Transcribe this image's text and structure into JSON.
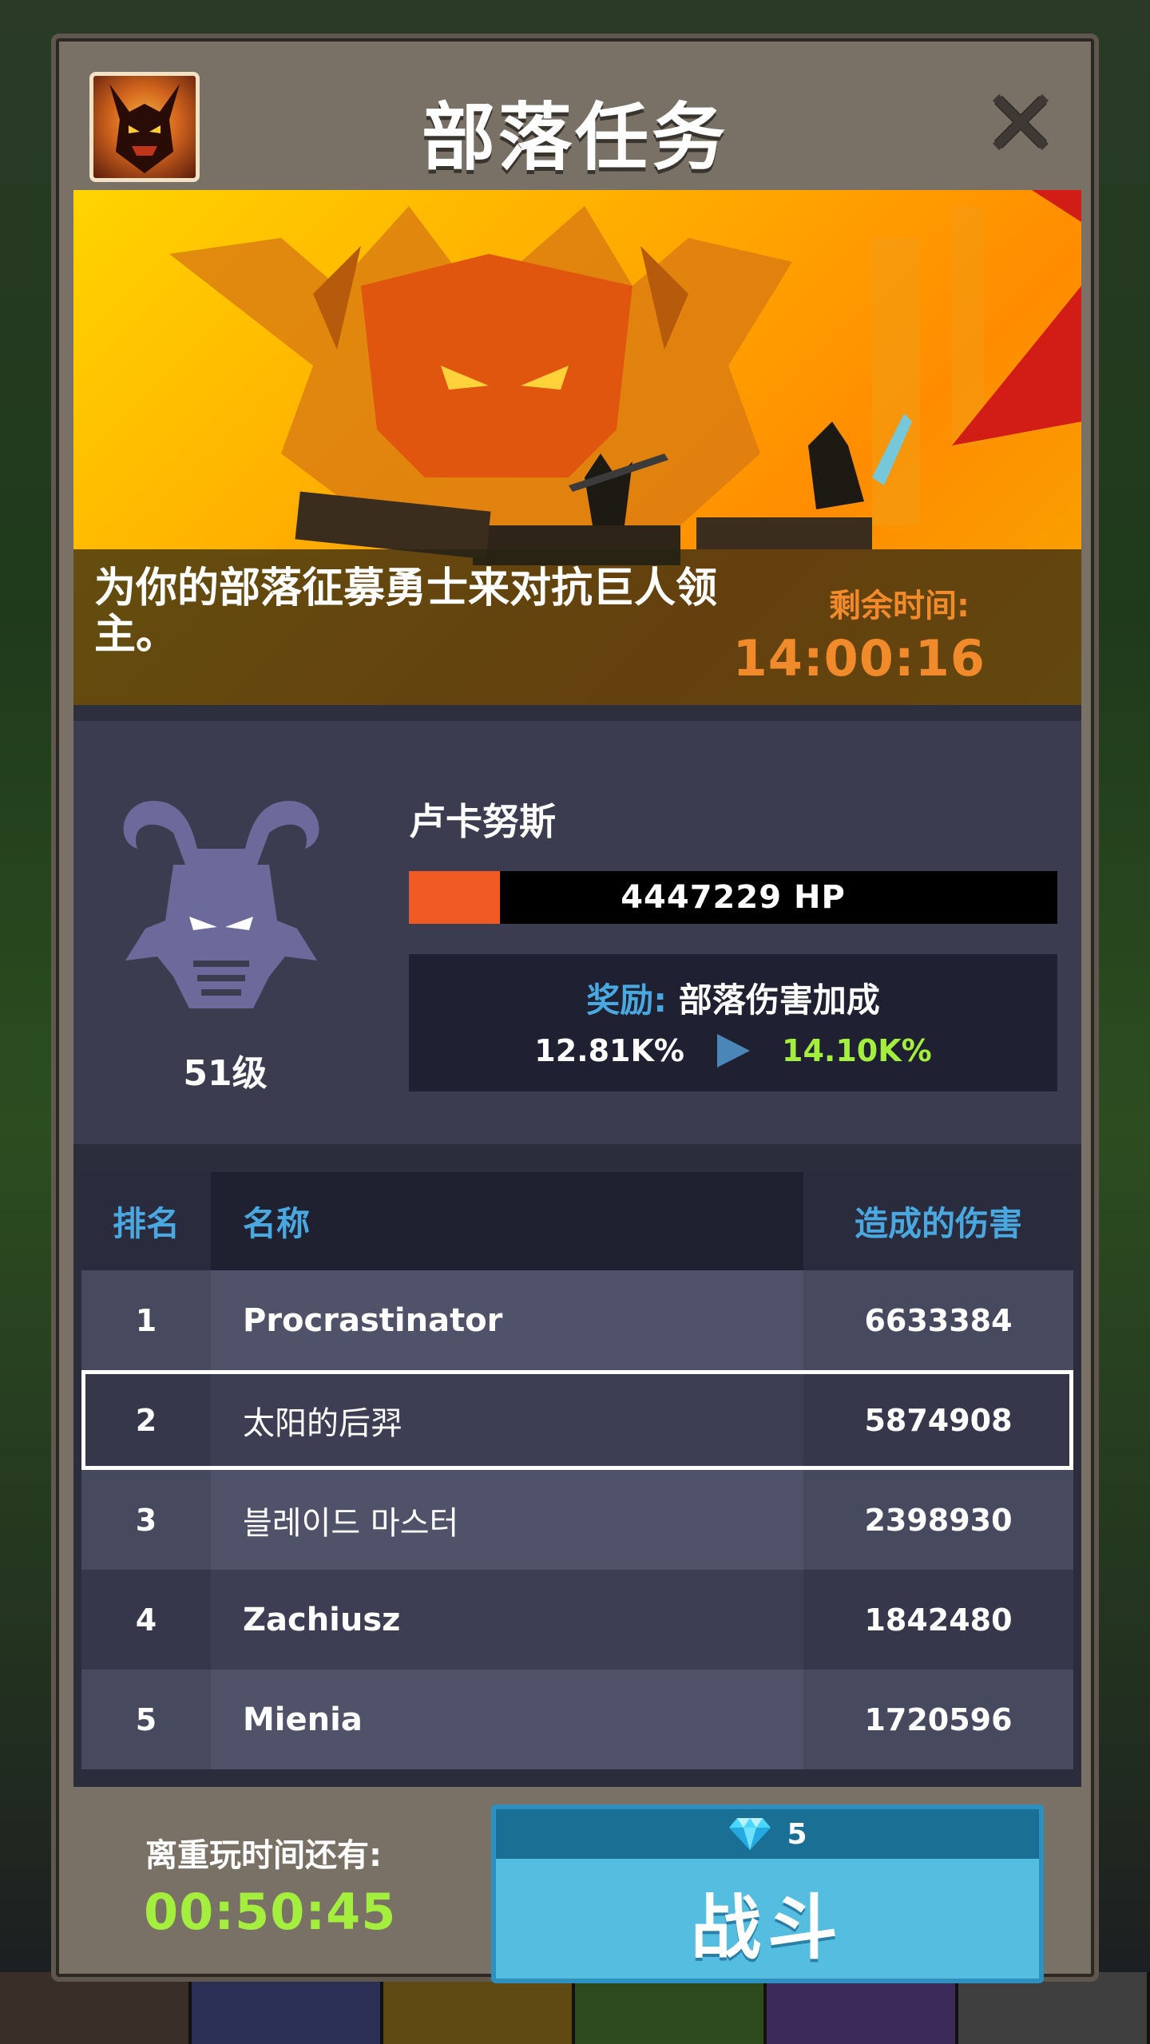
{
  "title": "部落任务",
  "banner": {
    "description": "为你的部落征募勇士来对抗巨人领主。",
    "time_label": "剩余时间:",
    "time_value": "14:00:16"
  },
  "boss": {
    "name": "卢卡努斯",
    "level": "51级",
    "hp_text": "4447229 HP",
    "hp_fraction": 0.14,
    "reward_label": "奖励:",
    "reward_name": "部落伤害加成",
    "reward_from": "12.81K%",
    "reward_to": "14.10K%"
  },
  "leaderboard": {
    "headers": {
      "rank": "排名",
      "name": "名称",
      "damage": "造成的伤害"
    },
    "rows": [
      {
        "rank": "1",
        "name": "Procrastinator",
        "damage": "6633384",
        "bold": true,
        "highlight": false
      },
      {
        "rank": "2",
        "name": "太阳的后羿",
        "damage": "5874908",
        "bold": false,
        "highlight": true
      },
      {
        "rank": "3",
        "name": "블레이드 마스터",
        "damage": "2398930",
        "bold": false,
        "highlight": false
      },
      {
        "rank": "4",
        "name": "Zachiusz",
        "damage": "1842480",
        "bold": true,
        "highlight": false
      },
      {
        "rank": "5",
        "name": "Mienia",
        "damage": "1720596",
        "bold": true,
        "highlight": false
      }
    ]
  },
  "footer": {
    "replay_label": "离重玩时间还有:",
    "replay_time": "00:50:45",
    "fight_cost": "5",
    "fight_label": "战斗"
  },
  "colors": {
    "accent_blue": "#4aa8e0",
    "accent_green": "#a4ef3e",
    "accent_orange": "#f08a2a",
    "hp_fill": "#f25a24"
  },
  "icons": {
    "close": "close-icon",
    "tribe": "tribe-avatar-icon",
    "boss": "horned-demon-icon",
    "arrow": "play-arrow-icon",
    "gem": "diamond-gem-icon"
  }
}
